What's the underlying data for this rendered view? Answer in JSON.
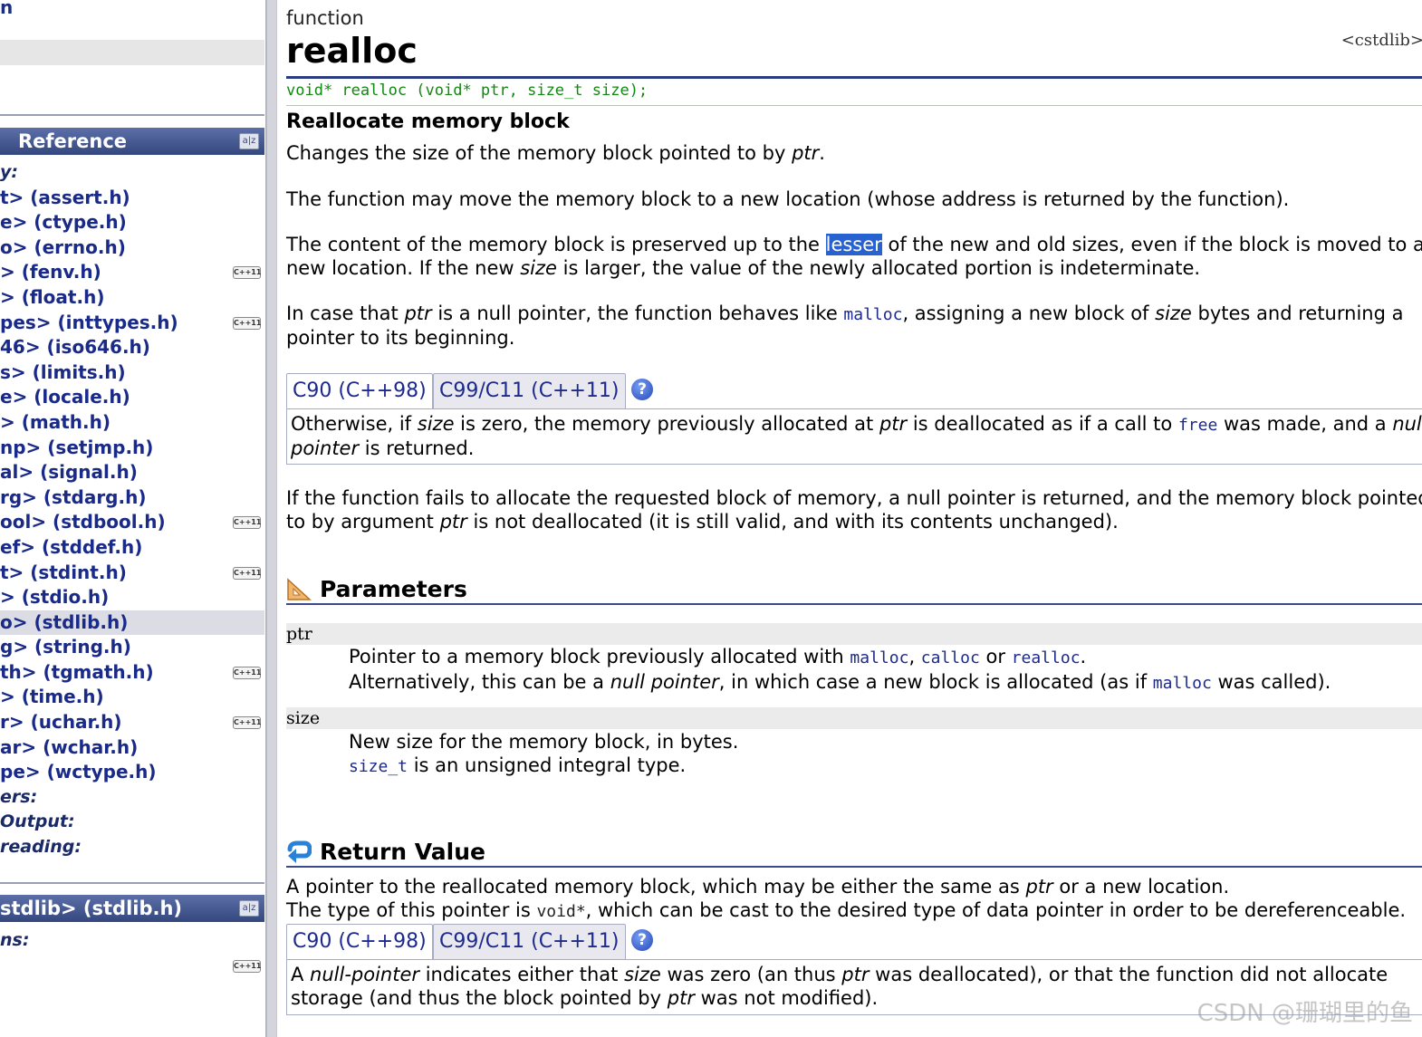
{
  "sidebar": {
    "top_fragment": "n",
    "section_reference": "Reference",
    "categories": {
      "libraries": "y:",
      "containers": "ers:",
      "input_output": "Output:",
      "multithreading": "reading:"
    },
    "headers": [
      {
        "label": "t> (assert.h)",
        "cpp11": false,
        "current": false
      },
      {
        "label": "e> (ctype.h)",
        "cpp11": false,
        "current": false
      },
      {
        "label": "o> (errno.h)",
        "cpp11": false,
        "current": false
      },
      {
        "label": "> (fenv.h)",
        "cpp11": true,
        "current": false
      },
      {
        "label": "> (float.h)",
        "cpp11": false,
        "current": false
      },
      {
        "label": "pes> (inttypes.h)",
        "cpp11": true,
        "current": false
      },
      {
        "label": "46> (iso646.h)",
        "cpp11": false,
        "current": false
      },
      {
        "label": "s> (limits.h)",
        "cpp11": false,
        "current": false
      },
      {
        "label": "e> (locale.h)",
        "cpp11": false,
        "current": false
      },
      {
        "label": "> (math.h)",
        "cpp11": false,
        "current": false
      },
      {
        "label": "np> (setjmp.h)",
        "cpp11": false,
        "current": false
      },
      {
        "label": "al> (signal.h)",
        "cpp11": false,
        "current": false
      },
      {
        "label": "rg> (stdarg.h)",
        "cpp11": false,
        "current": false
      },
      {
        "label": "ool> (stdbool.h)",
        "cpp11": true,
        "current": false
      },
      {
        "label": "ef> (stddef.h)",
        "cpp11": false,
        "current": false
      },
      {
        "label": "t> (stdint.h)",
        "cpp11": true,
        "current": false
      },
      {
        "label": "> (stdio.h)",
        "cpp11": false,
        "current": false
      },
      {
        "label": "o> (stdlib.h)",
        "cpp11": false,
        "current": true
      },
      {
        "label": "g> (string.h)",
        "cpp11": false,
        "current": false
      },
      {
        "label": "th> (tgmath.h)",
        "cpp11": true,
        "current": false
      },
      {
        "label": "> (time.h)",
        "cpp11": false,
        "current": false
      },
      {
        "label": "r> (uchar.h)",
        "cpp11": true,
        "current": false
      },
      {
        "label": "ar> (wchar.h)",
        "cpp11": false,
        "current": false
      },
      {
        "label": "pe> (wctype.h)",
        "cpp11": false,
        "current": false
      }
    ],
    "section_stdlib": "stdlib> (stdlib.h)",
    "stdlib_category": "ns:",
    "cpp11_badge": "C++11",
    "header_icon": "a|z"
  },
  "main": {
    "kind": "function",
    "name": "realloc",
    "header_file": "<cstdlib>",
    "prototype": "void* realloc (void* ptr, size_t size);",
    "short_description": "Reallocate memory block",
    "p1": {
      "a": "Changes the size of the memory block pointed to by ",
      "ptr": "ptr",
      "b": "."
    },
    "p2": "The function may move the memory block to a new location (whose address is returned by the function).",
    "p3": {
      "a": "The content of the memory block is preserved up to the ",
      "highlight": "lesser",
      "b": " of the new and old sizes, even if the block is moved to a",
      "c": "new location. If the new ",
      "size": "size",
      "d": " is larger, the value of the newly allocated portion is indeterminate."
    },
    "p4": {
      "a": "In case that ",
      "ptr": "ptr",
      "b": " is a null pointer, the function behaves like ",
      "malloc": "malloc",
      "c": ", assigning a new block of ",
      "size": "size",
      "d": " bytes and returning a",
      "e": "pointer to its beginning."
    },
    "tabs": {
      "c90": "C90 (C++98)",
      "c99": "C99/C11 (C++11)",
      "help": "?"
    },
    "tab1_body": {
      "a": "Otherwise, if ",
      "size": "size",
      "b": " is zero, the memory previously allocated at ",
      "ptr": "ptr",
      "c": " is deallocated as if a call to ",
      "free": "free",
      "d": " was made, and a ",
      "null": "null",
      "pointer": "pointer",
      "e": " is returned."
    },
    "p5": {
      "a": "If the function fails to allocate the requested block of memory, a null pointer is returned, and the memory block pointed",
      "b": "to by argument ",
      "ptr": "ptr",
      "c": " is not deallocated (it is still valid, and with its contents unchanged)."
    },
    "parameters": {
      "title": "Parameters",
      "ptr_name": "ptr",
      "ptr_desc1": {
        "a": "Pointer to a memory block previously allocated with ",
        "malloc": "malloc",
        "sep1": ", ",
        "calloc": "calloc",
        "sep2": " or ",
        "realloc": "realloc",
        "end": "."
      },
      "ptr_desc2": {
        "a": "Alternatively, this can be a ",
        "nullptr": "null pointer",
        "b": ", in which case a new block is allocated (as if ",
        "malloc": "malloc",
        "c": " was called)."
      },
      "size_name": "size",
      "size_desc1": "New size for the memory block, in bytes.",
      "size_desc2": {
        "size_t": "size_t",
        "a": " is an unsigned integral type."
      }
    },
    "return_value": {
      "title": "Return Value",
      "line1": {
        "a": "A pointer to the reallocated memory block, which may be either the same as ",
        "ptr": "ptr",
        "b": " or a new location."
      },
      "line2": {
        "a": "The type of this pointer is ",
        "void": "void*",
        "b": ", which can be cast to the desired type of data pointer in order to be dereferenceable."
      },
      "tab1_body": {
        "a": "A ",
        "nullpointer": "null-pointer",
        "b": " indicates either that ",
        "size": "size",
        "c": " was zero (an thus ",
        "ptr": "ptr",
        "d": " was deallocated), or that the function did not allocate",
        "e": "storage (and thus the block pointed by ",
        "ptr2": "ptr",
        "f": " was not modified)."
      }
    }
  },
  "watermark": "CSDN @珊瑚里的鱼"
}
